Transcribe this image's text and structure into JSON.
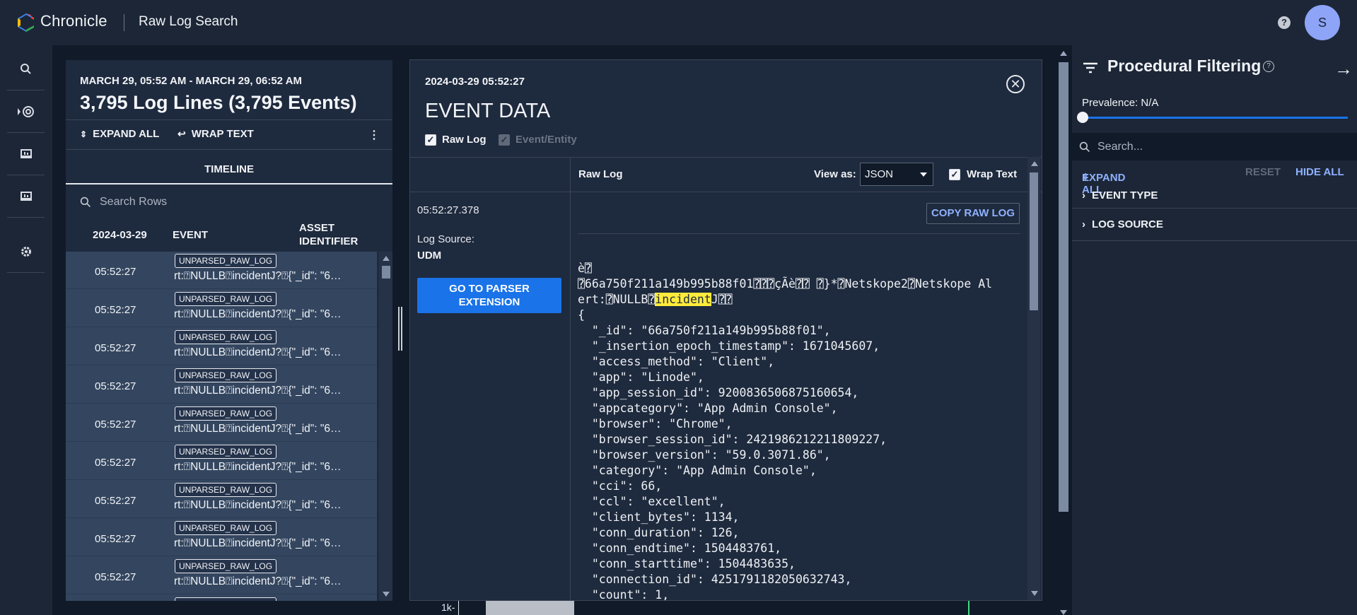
{
  "header": {
    "brand": "Chronicle",
    "app_title": "Raw Log Search",
    "help_icon": "help-icon",
    "avatar_initial": "S"
  },
  "rail": {
    "items": [
      "search-icon",
      "detections-icon",
      "dashboard-icon",
      "reports-icon",
      "settings-icon"
    ]
  },
  "results": {
    "range": "MARCH 29, 05:52 AM - MARCH 29, 06:52 AM",
    "count": "3,795 Log Lines (3,795 Events)",
    "expand_all": "EXPAND ALL",
    "wrap_text": "WRAP TEXT",
    "timeline_tab": "TIMELINE",
    "search_placeholder": "Search Rows",
    "columns": {
      "date": "2024-03-29",
      "event": "EVENT",
      "asset": "ASSET IDENTIFIER"
    },
    "rows": [
      {
        "time": "05:52:27",
        "badge": "UNPARSED_RAW_LOG",
        "event": "rt:⍰NULLB⍰incidentJ?⍰{\"_id\": \"6…"
      },
      {
        "time": "05:52:27",
        "badge": "UNPARSED_RAW_LOG",
        "event": "rt:⍰NULLB⍰incidentJ?⍰{\"_id\": \"6…"
      },
      {
        "time": "05:52:27",
        "badge": "UNPARSED_RAW_LOG",
        "event": "rt:⍰NULLB⍰incidentJ?⍰{\"_id\": \"6…"
      },
      {
        "time": "05:52:27",
        "badge": "UNPARSED_RAW_LOG",
        "event": "rt:⍰NULLB⍰incidentJ?⍰{\"_id\": \"6…"
      },
      {
        "time": "05:52:27",
        "badge": "UNPARSED_RAW_LOG",
        "event": "rt:⍰NULLB⍰incidentJ?⍰{\"_id\": \"6…"
      },
      {
        "time": "05:52:27",
        "badge": "UNPARSED_RAW_LOG",
        "event": "rt:⍰NULLB⍰incidentJ?⍰{\"_id\": \"6…"
      },
      {
        "time": "05:52:27",
        "badge": "UNPARSED_RAW_LOG",
        "event": "rt:⍰NULLB⍰incidentJ?⍰{\"_id\": \"6…"
      },
      {
        "time": "05:52:27",
        "badge": "UNPARSED_RAW_LOG",
        "event": "rt:⍰NULLB⍰incidentJ?⍰{\"_id\": \"6…"
      },
      {
        "time": "05:52:27",
        "badge": "UNPARSED_RAW_LOG",
        "event": "rt:⍰NULLB⍰incidentJ?⍰{\"_id\": \"6…"
      },
      {
        "time": "",
        "badge": "UNPARSED_RAW_LOG",
        "event": ""
      }
    ]
  },
  "event": {
    "timestamp": "2024-03-29 05:52:27",
    "title": "EVENT DATA",
    "raw_log_checkbox": "Raw Log",
    "event_entity_checkbox": "Event/Entity",
    "raw_log_header": "Raw Log",
    "view_as_label": "View as:",
    "view_as_value": "JSON",
    "wrap_text": "Wrap Text",
    "time": "05:52:27.378",
    "log_source_label": "Log Source:",
    "log_source_value": "UDM",
    "parser_button": "GO TO PARSER EXTENSION",
    "copy_button": "COPY RAW LOG",
    "code_head_1": "è⍰",
    "code_head_2": "⍰66a750f211a149b995b88f01⍰⍰⍰çÃè⍰⍰ ⍰}*⍰Netskope2⍰Netskope Al",
    "code_head_3a": "ert:⍰NULLB⍰",
    "code_highlight": "incident",
    "code_head_3b": "J⍰⍰",
    "code_lines": [
      "{",
      "  \"_id\": \"66a750f211a149b995b88f01\",",
      "  \"_insertion_epoch_timestamp\": 1671045607,",
      "  \"access_method\": \"Client\",",
      "  \"app\": \"Linode\",",
      "  \"app_session_id\": 9200836506875160654,",
      "  \"appcategory\": \"App Admin Console\",",
      "  \"browser\": \"Chrome\",",
      "  \"browser_session_id\": 2421986212211809227,",
      "  \"browser_version\": \"59.0.3071.86\",",
      "  \"category\": \"App Admin Console\",",
      "  \"cci\": 66,",
      "  \"ccl\": \"excellent\",",
      "  \"client_bytes\": 1134,",
      "  \"conn_duration\": 126,",
      "  \"conn_endtime\": 1504483761,",
      "  \"conn_starttime\": 1504483635,",
      "  \"connection_id\": 4251791182050632743,",
      "  \"count\": 1,"
    ]
  },
  "histogram": {
    "tick_label": "1k-"
  },
  "filter_panel": {
    "title": "Procedural Filtering",
    "prevalence": "Prevalence: N/A",
    "search_placeholder": "Search...",
    "expand_all": "EXPAND ALL",
    "reset": "RESET",
    "hide_all": "HIDE ALL",
    "sections": [
      "EVENT TYPE",
      "LOG SOURCE"
    ]
  },
  "colors": {
    "accent": "#1a73e8",
    "link": "#8fb1ff",
    "highlight": "#ffeb3b"
  }
}
